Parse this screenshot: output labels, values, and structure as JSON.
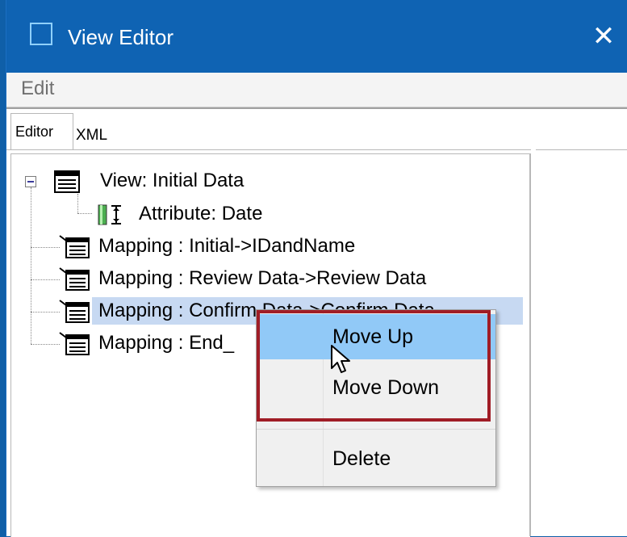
{
  "window": {
    "title": "View Editor",
    "icons": {
      "app": "window-icon",
      "close": "close-icon"
    }
  },
  "menubar": {
    "items": [
      {
        "label": "Edit"
      }
    ]
  },
  "tabs": [
    {
      "label": "Editor"
    },
    {
      "label": "XML"
    }
  ],
  "tree": {
    "root": {
      "label": "View: Initial Data",
      "icon": "view-icon"
    },
    "children": [
      {
        "label": "Attribute: Date",
        "icon": "attribute-icon"
      },
      {
        "label": "Mapping : Initial->IDandName",
        "icon": "mapping-icon"
      },
      {
        "label": "Mapping : Review Data->Review Data",
        "icon": "mapping-icon"
      },
      {
        "label": "Mapping : Confirm Data->Confirm Data",
        "icon": "mapping-icon"
      },
      {
        "label": "Mapping : End_",
        "icon": "mapping-icon"
      }
    ]
  },
  "context_menu": {
    "items": [
      {
        "label": "Move Up"
      },
      {
        "label": "Move Down"
      },
      {
        "label": "Delete"
      }
    ]
  },
  "colors": {
    "titlebar": "#0f63b3",
    "selection": "#c7d9f2",
    "menu_hover": "#91c9f7",
    "highlight_border": "#a01d26"
  }
}
